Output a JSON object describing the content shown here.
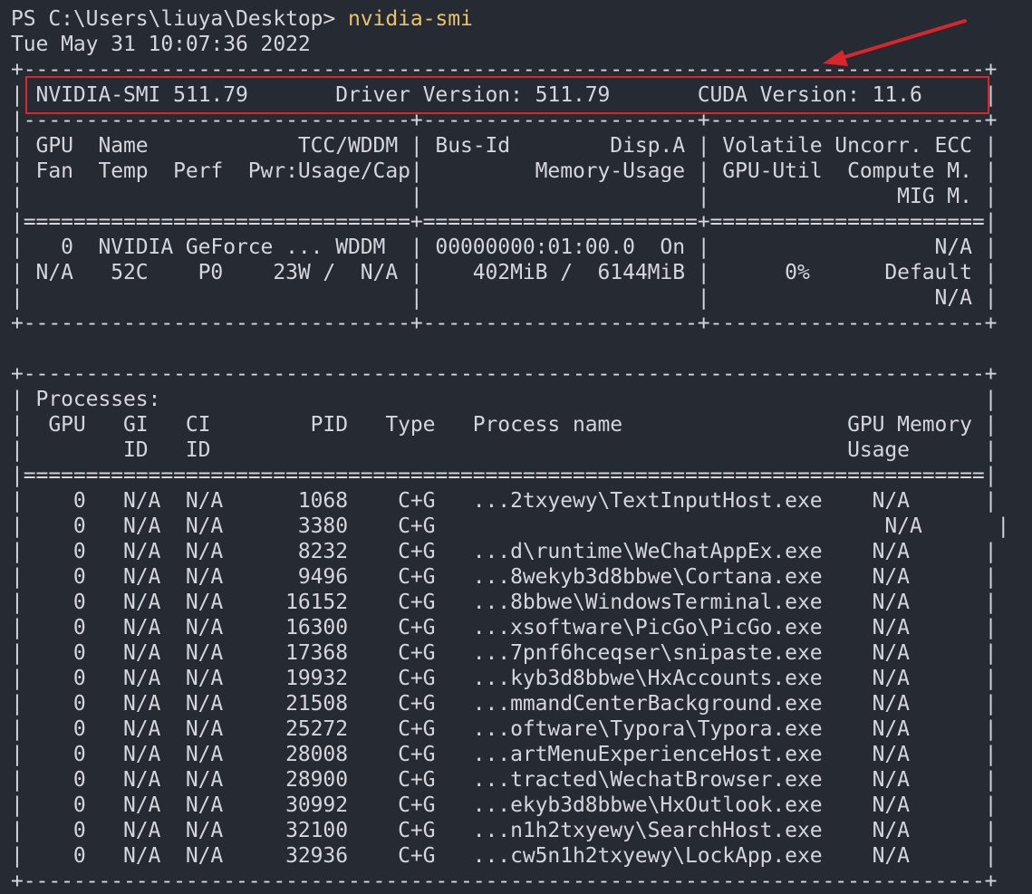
{
  "prompt": {
    "prefix": "PS C:\\Users\\liuya\\Desktop> ",
    "command": "nvidia-smi"
  },
  "timestamp": "Tue May 31 10:07:36 2022",
  "gpu_table": {
    "border_top": "+-----------------------------------------------------------------------------+",
    "versions_row": "| NVIDIA-SMI 511.79       Driver Version: 511.79       CUDA Version: 11.6     |",
    "divider_dashes": "|-------------------------------+----------------------+----------------------+",
    "header_row_1": "| GPU  Name            TCC/WDDM | Bus-Id        Disp.A | Volatile Uncorr. ECC |",
    "header_row_2": "| Fan  Temp  Perf  Pwr:Usage/Cap|         Memory-Usage | GPU-Util  Compute M. |",
    "header_row_3": "|                               |                      |               MIG M. |",
    "divider_equals": "|===============================+======================+======================|",
    "gpu_row_1": "|   0  NVIDIA GeForce ... WDDM  | 00000000:01:00.0  On |                  N/A |",
    "gpu_row_2": "| N/A   52C    P0    23W /  N/A |    402MiB /  6144MiB |      0%      Default |",
    "gpu_row_3": "|                               |                      |                  N/A |",
    "border_bottom": "+-------------------------------+----------------------+----------------------+"
  },
  "process_table": {
    "border_top": "+-----------------------------------------------------------------------------+",
    "title_row": "| Processes:                                                                  |",
    "header_row_1": "|  GPU   GI   CI        PID   Type   Process name                  GPU Memory |",
    "header_row_2": "|        ID   ID                                                   Usage      |",
    "divider_equals": "|=============================================================================|",
    "rows": [
      "|    0   N/A  N/A      1068    C+G   ...2txyewy\\TextInputHost.exe    N/A      |",
      "|    0   N/A  N/A      3380    C+G                                    N/A      |",
      "|    0   N/A  N/A      8232    C+G   ...d\\runtime\\WeChatAppEx.exe    N/A      |",
      "|    0   N/A  N/A      9496    C+G   ...8wekyb3d8bbwe\\Cortana.exe    N/A      |",
      "|    0   N/A  N/A     16152    C+G   ...8bbwe\\WindowsTerminal.exe    N/A      |",
      "|    0   N/A  N/A     16300    C+G   ...xsoftware\\PicGo\\PicGo.exe    N/A      |",
      "|    0   N/A  N/A     17368    C+G   ...7pnf6hceqser\\snipaste.exe    N/A      |",
      "|    0   N/A  N/A     19932    C+G   ...kyb3d8bbwe\\HxAccounts.exe    N/A      |",
      "|    0   N/A  N/A     21508    C+G   ...mmandCenterBackground.exe    N/A      |",
      "|    0   N/A  N/A     25272    C+G   ...oftware\\Typora\\Typora.exe    N/A      |",
      "|    0   N/A  N/A     28008    C+G   ...artMenuExperienceHost.exe    N/A      |",
      "|    0   N/A  N/A     28900    C+G   ...tracted\\WechatBrowser.exe    N/A      |",
      "|    0   N/A  N/A     30992    C+G   ...ekyb3d8bbwe\\HxOutlook.exe    N/A      |",
      "|    0   N/A  N/A     32100    C+G   ...n1h2txyewy\\SearchHost.exe    N/A      |",
      "|    0   N/A  N/A     32936    C+G   ...cw5n1h2txyewy\\LockApp.exe    N/A      |"
    ],
    "border_bottom": "+-----------------------------------------------------------------------------+"
  },
  "annotation": {
    "box_color": "#d9262a",
    "arrow_color": "#d9262a"
  }
}
